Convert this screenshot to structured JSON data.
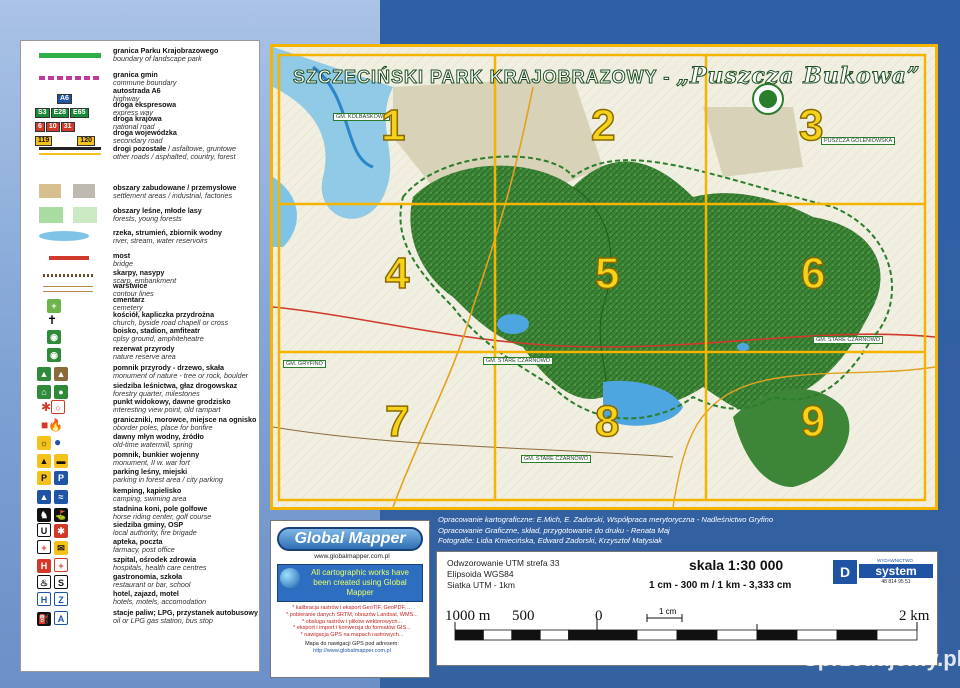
{
  "map": {
    "title_main": "SZCZECIŃSKI PARK KRAJOBRAZOWY - ",
    "title_script": "„Puszcza Bukowa”",
    "cell_numbers": [
      "1",
      "2",
      "3",
      "4",
      "5",
      "6",
      "7",
      "8",
      "9"
    ],
    "place_labels": [
      "GM. KOLBASKOWO",
      "GM. GRYFINO",
      "GM. STARE CZARNOWO",
      "GM. STARE CZARNOWO",
      "GM. STARE CZARNOWO",
      "PUSZCZA GOLENIOWSKA"
    ]
  },
  "legend": {
    "items": [
      {
        "pl": "granica Parku Krajobrazowego",
        "en": "boundary of  landscape park"
      },
      {
        "pl": "granica gmin",
        "en": "commune boundary"
      },
      {
        "pl": "autostrada A6",
        "en": "highway",
        "badge": "A6"
      },
      {
        "pl": "droga ekspresowa",
        "en": "express way",
        "badge": "S3 E28 E65"
      },
      {
        "pl": "droga krajowa",
        "en": "national road",
        "badge": "6 10 31"
      },
      {
        "pl": "droga wojewódzka",
        "en": "secondary road",
        "badge": "119 120"
      },
      {
        "pl": "drogi pozostałe",
        "en": "other roads / asphalted, country, forest",
        "pl_extra": "asfaltowe, gruntowe"
      },
      {
        "pl": "obszary zabudowane / przemysłowe",
        "en": "settlement areas / industrial, factories"
      },
      {
        "pl": "obszary leśne, młode lasy",
        "en": "forests, young forests"
      },
      {
        "pl": "rzeka, strumień, zbiornik wodny",
        "en": "river, stream, water reservoirs"
      },
      {
        "pl": "most",
        "en": "bridge"
      },
      {
        "pl": "skarpy, nasypy",
        "en": "scarp, embankment"
      },
      {
        "pl": "warstwice",
        "en": "contour lines"
      },
      {
        "pl": "cmentarz",
        "en": "cemetery"
      },
      {
        "pl": "kościół, kapliczka przydrożna",
        "en": "church, byside road chapell or cross"
      },
      {
        "pl": "boisko, stadion, amfiteatr",
        "en": "cplsy ground, amphiteheatre"
      },
      {
        "pl": "rezerwat przyrody",
        "en": "nature reserve area"
      },
      {
        "pl": "pomnik przyrody - drzewo, skała",
        "en": "monument of nature - tree or rock, boulder"
      },
      {
        "pl": "siedziba leśnictwa, głaz drogowskaz",
        "en": "forestry quarter, milestones"
      },
      {
        "pl": "punkt widokowy, dawne grodzisko",
        "en": "interesting view point, old rampart"
      },
      {
        "pl": "graniczniki, morowce, miejsce na ognisko",
        "en": "oborder poles, place for bonfire"
      },
      {
        "pl": "dawny młyn wodny, źródło",
        "en": "old-time watermill, spring"
      },
      {
        "pl": "pomnik, bunkier wojenny",
        "en": "monument, II w. war fort"
      },
      {
        "pl": "parking leśny, miejski",
        "en": "parking in forest area / city parking"
      },
      {
        "pl": "kemping, kąpielisko",
        "en": "camping, swiming area"
      },
      {
        "pl": "stadnina koni, pole golfowe",
        "en": "horse riding center, golf course"
      },
      {
        "pl": "siedziba gminy, OSP",
        "en": "local authority, fire brigade"
      },
      {
        "pl": "apteka, poczta",
        "en": "farmacy, post office"
      },
      {
        "pl": "szpital, ośrodek zdrowia",
        "en": "hospitals, health care centres"
      },
      {
        "pl": "gastronomia, szkoła",
        "en": "restaurant or bar, school"
      },
      {
        "pl": "hotel, zajazd, motel",
        "en": "hotels, motels, accomodation"
      },
      {
        "pl": "stacje paliw; LPG, przystanek autobusowy",
        "en": "oil or LPG gas station, bus stop"
      }
    ]
  },
  "global_mapper": {
    "logo": "Global Mapper",
    "url": "www.globalmapper.com.pl",
    "banner": "All cartographic works have been created using Global Mapper",
    "notes": [
      "* kalibracja rastrów i eksport GeoTIF, GeoPDF, ...",
      "* pobieranie danych SRTM, obrazów Landsat, WMS...",
      "* obsługa rastrów i plików wektorowych...",
      "* eksport i import i konwersja do formatów GIS...",
      "* nawigacja GPS na mapach rastrowych..."
    ],
    "footer": "Mapa do nawigacji GPS pod adresem:",
    "footer_url": "http://www.globalmapper.com.pl"
  },
  "credits": [
    "Opracowanie kartograficzne: E.Mich, E. Zadorski, Współpraca merytoryczna - Nadleśnictwo Gryfino",
    "Opracowanie Graficzne, skład, przygotowanie do druku - Renata Maj",
    "Fotografie: Lidia Kmiecińska, Edward Zadorski, Krzysztof Matysiak"
  ],
  "scale": {
    "utm": "Odwzorowanie UTM strefa 33",
    "ellipsoid": "Elipsoida WGS84",
    "grid": "Siatka UTM - 1km",
    "title": "skala  1:30 000",
    "conversion": "1 cm - 300 m   /   1 km - 3,333 cm",
    "labels": [
      "1000 m",
      "500",
      "0",
      "2 km"
    ],
    "cm_label": "1 cm",
    "publisher_top": "WYDAWNICTWO KARTOGRAFICZNE",
    "publisher": "system",
    "publisher_phone": "48 814 95 51"
  },
  "watermark": "Sprzedajemy.pl",
  "colors": {
    "forest": "#3f8a3a",
    "cell_border": "#f4b400",
    "map_frame": "#f4b400",
    "cell_number": "#f7d21a"
  }
}
